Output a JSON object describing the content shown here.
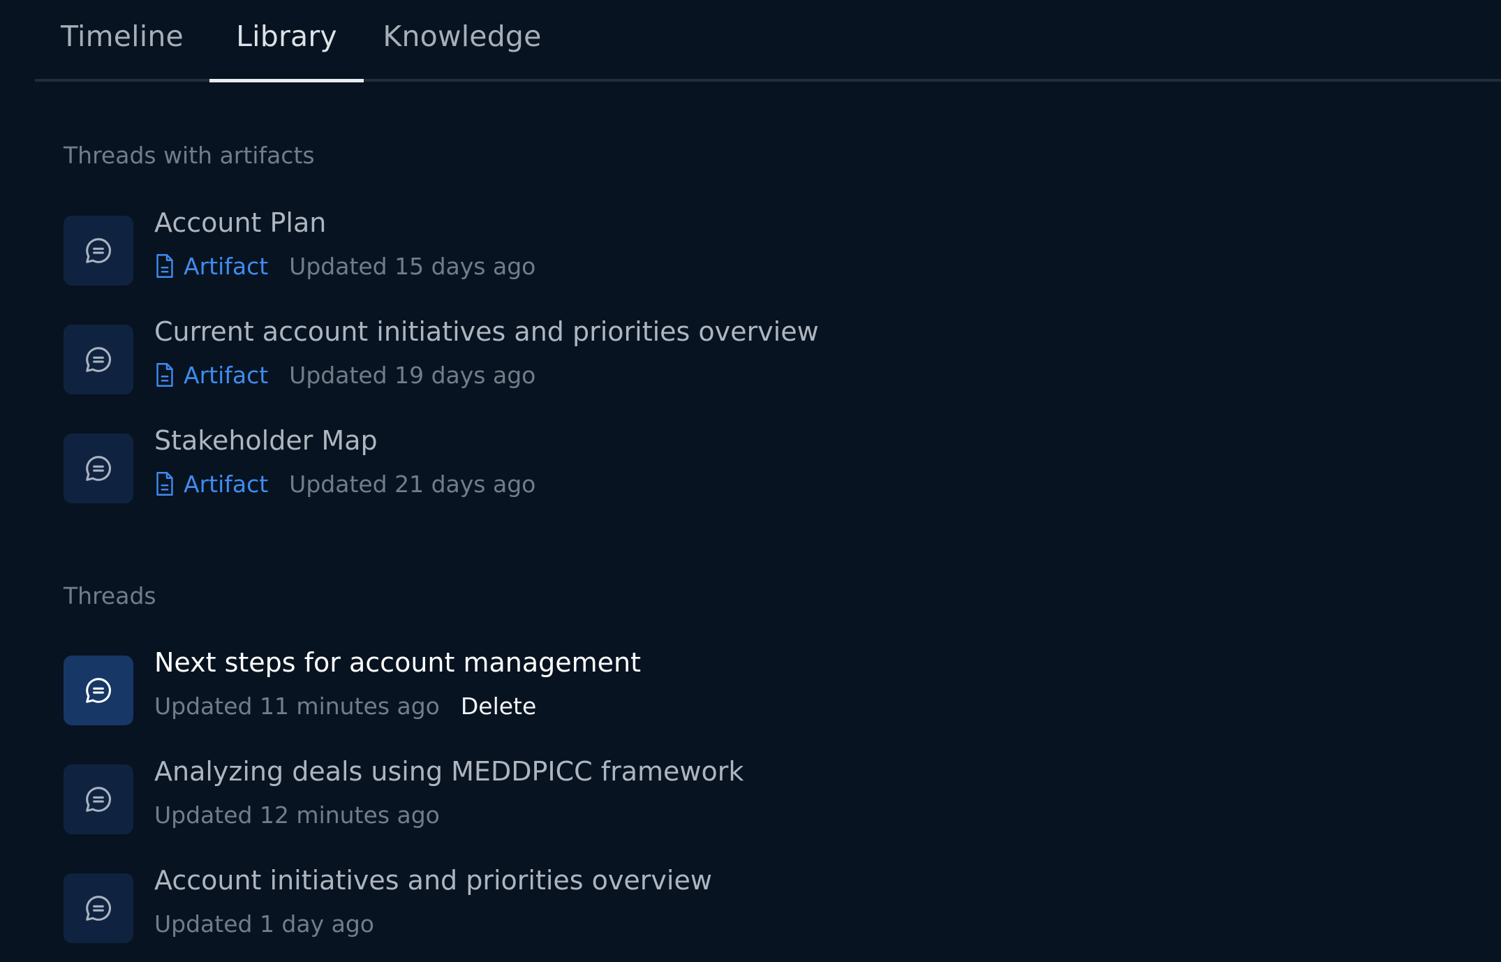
{
  "tabs": [
    {
      "label": "Timeline"
    },
    {
      "label": "Library"
    },
    {
      "label": "Knowledge"
    }
  ],
  "active_tab": "Library",
  "sections": {
    "artifacts": {
      "heading": "Threads with artifacts",
      "items": [
        {
          "title": "Account Plan",
          "tag": "Artifact",
          "updated": "Updated 15 days ago"
        },
        {
          "title": "Current account initiatives and priorities overview",
          "tag": "Artifact",
          "updated": "Updated 19 days ago"
        },
        {
          "title": "Stakeholder Map",
          "tag": "Artifact",
          "updated": "Updated 21 days ago"
        }
      ]
    },
    "threads": {
      "heading": "Threads",
      "items": [
        {
          "title": "Next steps for account management",
          "updated": "Updated 11 minutes ago",
          "action": "Delete"
        },
        {
          "title": "Analyzing deals using MEDDPICC framework",
          "updated": "Updated 12 minutes ago"
        },
        {
          "title": "Account initiatives and priorities overview",
          "updated": "Updated 1 day ago"
        }
      ]
    }
  },
  "icons": {
    "thread": "chat-bubble-icon",
    "artifact": "document-icon"
  },
  "colors": {
    "background": "#071320",
    "accent": "#3f8cf0",
    "icon_tile": "#0f2340",
    "icon_tile_active": "#173766"
  }
}
